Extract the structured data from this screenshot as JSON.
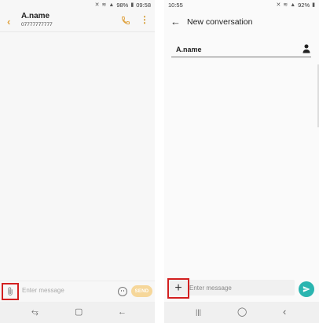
{
  "left": {
    "status": {
      "battery": "98%",
      "time": "09:58"
    },
    "header": {
      "back_icon": "chevron-left-icon",
      "contact_name": "A.name",
      "contact_number": "07777777777",
      "call_icon": "phone-icon",
      "more_icon": "more-vertical-icon"
    },
    "compose": {
      "attach_icon": "paperclip-icon",
      "placeholder": "Enter message",
      "emoji_icon": "smiley-icon",
      "send_label": "SEND"
    },
    "nav": {
      "recents": "⥃",
      "home": "▢",
      "back": "←"
    }
  },
  "right": {
    "status": {
      "time": "10:55",
      "battery": "92%"
    },
    "header": {
      "back_icon": "arrow-left-icon",
      "title": "New conversation"
    },
    "recipient": {
      "name": "A.name",
      "contact_icon": "person-icon"
    },
    "compose": {
      "add_icon": "plus-icon",
      "add_glyph": "+",
      "placeholder": "Enter message",
      "send_icon": "send-icon"
    },
    "nav": {
      "recents": "|||",
      "home": "◯",
      "back": "‹"
    }
  },
  "colors": {
    "accent_orange": "#e0a340",
    "send_disabled": "#f6d79a",
    "send_teal": "#2bb5b0",
    "highlight_red": "#d32020"
  }
}
